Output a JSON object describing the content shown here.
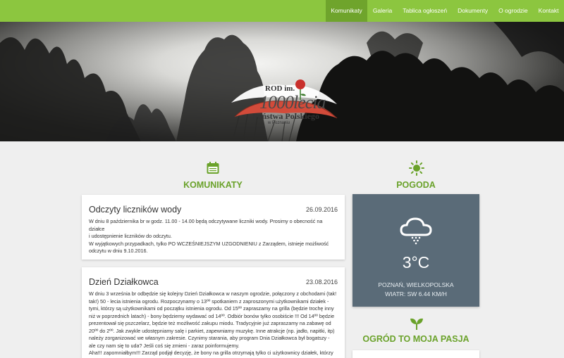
{
  "nav": {
    "items": [
      {
        "label": "Komunikaty",
        "active": true
      },
      {
        "label": "Galeria",
        "active": false
      },
      {
        "label": "Tablica ogłoszeń",
        "active": false
      },
      {
        "label": "Dokumenty",
        "active": false
      },
      {
        "label": "O ogrodzie",
        "active": false
      },
      {
        "label": "Kontakt",
        "active": false
      }
    ]
  },
  "logo": {
    "line1": "ROD im.",
    "line2": "1000lecia",
    "line3": "Państwa Polskiego",
    "line4": "w Poznaniu"
  },
  "colors": {
    "brand_green": "#8cc63f",
    "nav_active": "#6fa42c",
    "heading_green": "#6aa22a",
    "weather_bg": "#5a6b78"
  },
  "komunikaty": {
    "icon": "calendar-icon",
    "title": "KOMUNIKATY",
    "posts": [
      {
        "title": "Odczyty liczników wody",
        "date": "26.09.2016",
        "lines": [
          "W dniu 8 października br w godz. 11.00 - 14.00 będą odczytywane liczniki wody. Prosimy o obecność na działce",
          "i udostępnienie liczników do odczytu.",
          "W wyjątkowych przypadkach, tylko PO WCZEŚNIEJSZYM UZGODNIENIU z Zarządem, istnieje możliwość odczytu w dniu 9.10.2016."
        ]
      },
      {
        "title": "Dzień Działkowca",
        "date": "23.08.2016",
        "lines": [
          "W dniu 3 września br odbędzie się kolejny Dzień Działkowca w naszym ogrodzie, połączony z obchodami (tak! tak!) 50 - lecia istnienia ogrodu. Rozpoczynamy o 13ºº spotkaniem z zaproszonymi użytkownikami działek - tymi, którzy są użytkownikami od początku istnienia ogrodu. Od 15ºº zapraszamy na grilla (będzie trochę inny niż w poprzednich latach) - bony będziemy wydawać od 14ºº. Odbiór bonów tylko osobiście !!! Od 14ºº będzie prezentował się pszczelarz, będzie też możliwość zakupu miodu. Tradycyjnie już zapraszamy na zabawę od 20ºº do 2ºº. Jak zwykle udostępniamy salę i parkiet, zapewniamy muzykę. Inne atrakcje (np. jadło, napitki, itp) należy zorganizować we własnym zakresie. Czynimy starania, aby program Dnia Działkowca był bogatszy - ale czy nam się to uda? Jeśli coś się zmieni - zaraz poinformujemy.",
          "Aha!!! zapomniałbym!!! Zarząd podjął decyzję, że bony na grilla otrzymają tylko ci użytkownicy działek, którzy"
        ]
      }
    ]
  },
  "pogoda": {
    "icon": "sun-icon",
    "title": "POGODA",
    "weather_icon": "snow-cloud-icon",
    "temperature": "3°C",
    "location": "POZNAŃ, WIELKOPOLSKA",
    "wind": "WIATR: SW 6.44 KM/H"
  },
  "ogrod": {
    "icon": "sprout-icon",
    "title": "OGRÓD TO MOJA PASJA"
  }
}
